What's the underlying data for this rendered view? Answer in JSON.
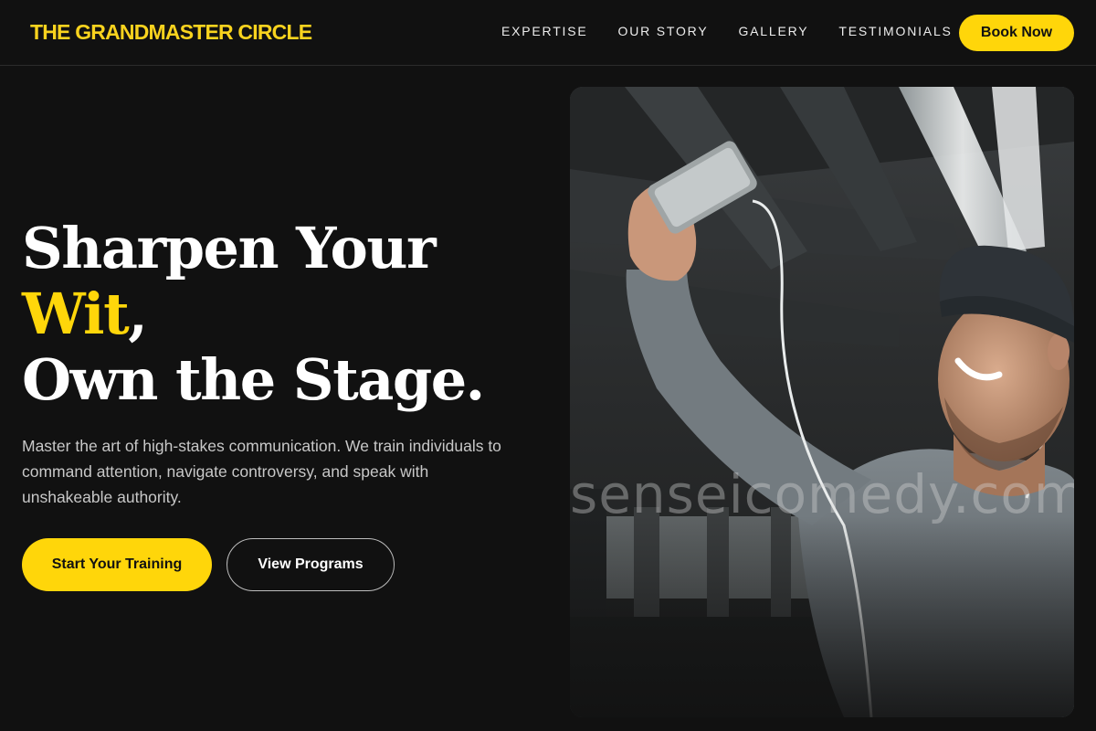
{
  "brand": {
    "name": "THE GRANDMASTER CIRCLE"
  },
  "nav": {
    "links": [
      "EXPERTISE",
      "OUR STORY",
      "GALLERY",
      "TESTIMONIALS"
    ],
    "cta": "Book Now"
  },
  "hero": {
    "headline_line1": "Sharpen Your",
    "headline_accent": "Wit",
    "headline_comma": ",",
    "headline_line3": "Own the Stage.",
    "description": "Master the art of high-stakes communication. We train individuals to command attention, navigate controversy, and speak with unshakeable authority.",
    "primary_button": "Start Your Training",
    "secondary_button": "View Programs"
  },
  "image": {
    "subject": "man in grey hoodie and beanie taking a selfie with a smartphone under a concrete overpass",
    "watermark": "senseicomedy.com"
  },
  "colors": {
    "background": "#111111",
    "accent": "#ffd60a",
    "text": "#ffffff",
    "muted_text": "#c8c8c8"
  }
}
